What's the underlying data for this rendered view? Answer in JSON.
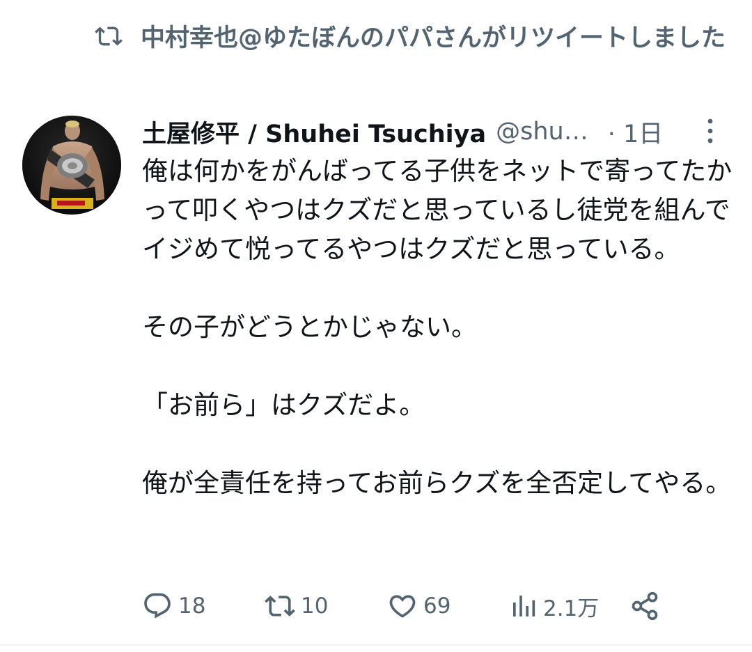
{
  "social_context": {
    "icon": "retweet-icon",
    "text": "中村幸也@ゆたぼんのパパさんがリツイートしました"
  },
  "tweet": {
    "author": {
      "display_name": "土屋修平 / Shuhei Tsuchiya",
      "handle": "@shu…",
      "avatar": "avatar-fighter-with-belt"
    },
    "time": "· 1日",
    "paragraphs": [
      "俺は何かをがんばってる子供をネットで寄ってたかって叩くやつはクズだと思っているし徒党を組んでイジめて悦ってるやつはクズだと思っている。",
      "その子がどうとかじゃない。",
      "「お前ら」はクズだよ。",
      "俺が全責任を持ってお前らクズを全否定してやる。"
    ],
    "actions": {
      "reply": {
        "icon": "reply-icon",
        "count": "18"
      },
      "retweet": {
        "icon": "retweet-icon",
        "count": "10"
      },
      "like": {
        "icon": "heart-icon",
        "count": "69"
      },
      "views": {
        "icon": "views-icon",
        "count": "2.1万"
      },
      "share": {
        "icon": "share-icon"
      }
    }
  },
  "colors": {
    "text_primary": "#0f1419",
    "text_secondary": "#536471",
    "divider": "#eff3f4",
    "background": "#ffffff"
  }
}
